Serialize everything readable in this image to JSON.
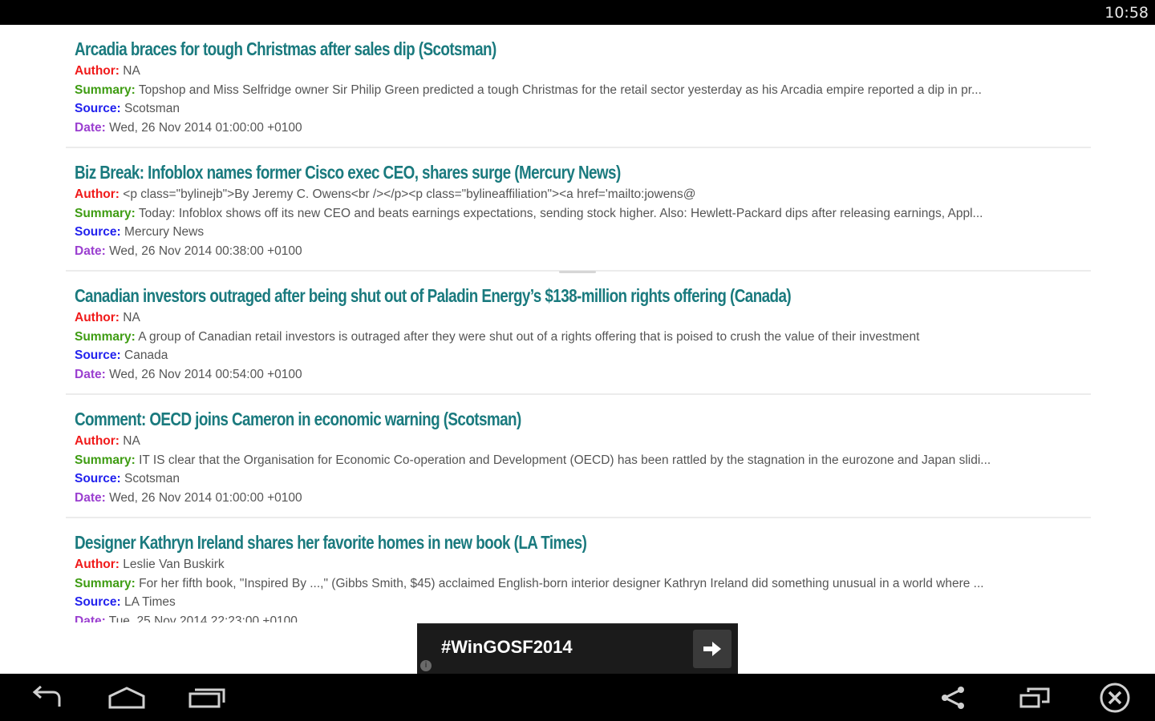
{
  "status_bar": {
    "time": "10:58"
  },
  "labels": {
    "author": "Author:",
    "summary": "Summary:",
    "source": "Source:",
    "date": "Date:"
  },
  "articles": [
    {
      "title": "Arcadia braces for tough Christmas after sales dip (Scotsman)",
      "author": "NA",
      "summary": "Topshop and Miss Selfridge owner Sir Philip Green predicted a tough Christmas for the retail sector yesterday as his Arcadia empire reported a dip in pr...",
      "source": "Scotsman",
      "date": "Wed, 26 Nov 2014 01:00:00 +0100"
    },
    {
      "title": "Biz Break: Infoblox names former Cisco exec CEO, shares surge (Mercury News)",
      "author": "<p class=\"bylinejb\">By Jeremy C. Owens<br /></p><p class=\"bylineaffiliation\"><a href='mailto:jowens@",
      "summary": "Today: Infoblox shows off its new CEO and beats earnings expectations, sending stock higher. Also: Hewlett-Packard dips after releasing earnings, Appl...",
      "source": "Mercury News",
      "date": "Wed, 26 Nov 2014 00:38:00 +0100"
    },
    {
      "title": "Canadian investors outraged after being shut out of Paladin Energy’s $138-million rights offering (Canada)",
      "author": "NA",
      "summary": "A group of Canadian retail investors is outraged after they were shut out of a rights offering that is poised to crush the value of their investment",
      "source": "Canada",
      "date": "Wed, 26 Nov 2014 00:54:00 +0100"
    },
    {
      "title": "Comment: OECD joins Cameron in economic warning (Scotsman)",
      "author": "NA",
      "summary": "IT IS clear that the Organisation for Economic Co-operation and Development (OECD) has been rattled by the stagnation in the eurozone and Japan slidi...",
      "source": "Scotsman",
      "date": "Wed, 26 Nov 2014 01:00:00 +0100"
    },
    {
      "title": "Designer Kathryn Ireland shares her favorite homes in new book (LA Times)",
      "author": "Leslie Van Buskirk",
      "summary": "For her fifth book, \"Inspired By ...,\" (Gibbs Smith, $45) acclaimed English-born interior designer Kathryn Ireland did something unusual in a world where ...",
      "source": "LA Times",
      "date": "Tue, 25 Nov 2014 22:23:00 +0100"
    }
  ],
  "ad": {
    "text": "#WinGOSF2014",
    "info": "i"
  },
  "nav_bar": {
    "left": [
      "back-icon",
      "home-icon",
      "recent-apps-icon"
    ],
    "right": [
      "share-icon",
      "screen-toggle-icon",
      "close-icon"
    ]
  },
  "colors": {
    "title": "#1a7a7e",
    "author_label": "#f01a1a",
    "summary_label": "#3e9c12",
    "source_label": "#2222ee",
    "date_label": "#9b3fd0"
  }
}
